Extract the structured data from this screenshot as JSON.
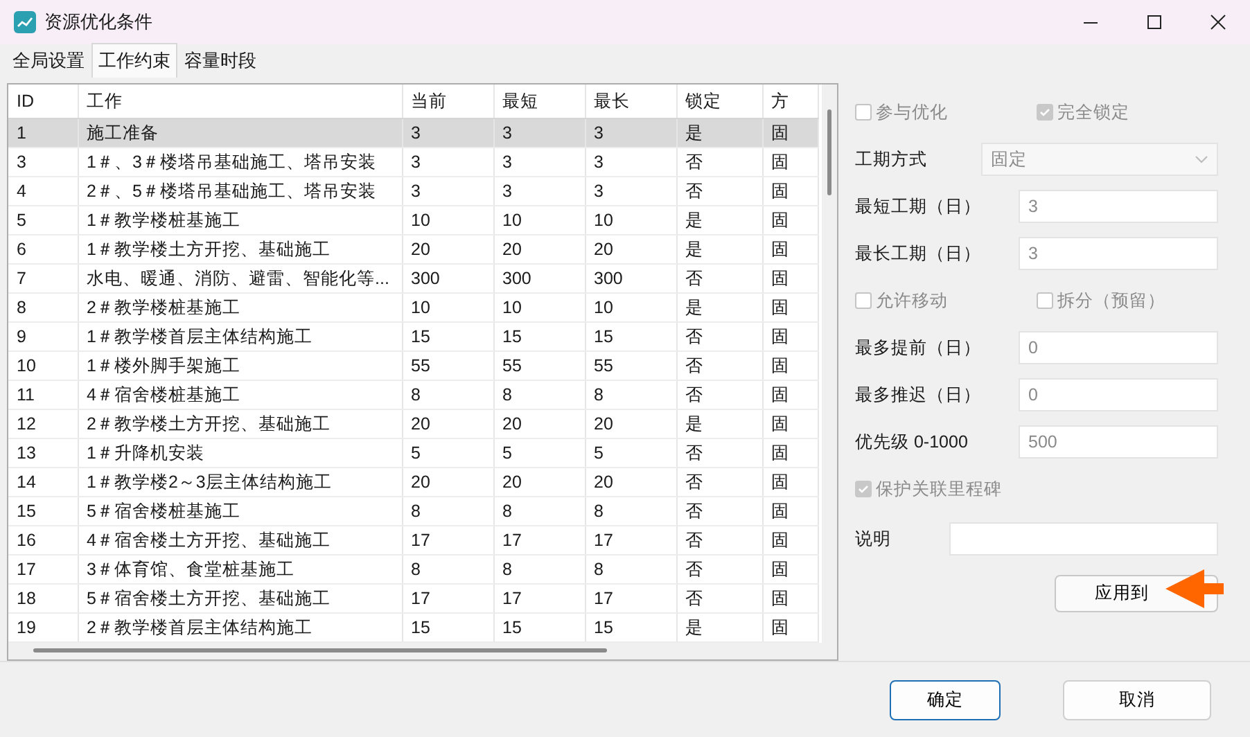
{
  "window": {
    "title": "资源优化条件"
  },
  "tabs": [
    {
      "label": "全局设置",
      "selected": false
    },
    {
      "label": "工作约束",
      "selected": true
    },
    {
      "label": "容量时段",
      "selected": false
    }
  ],
  "table": {
    "columns": [
      "ID",
      "工作",
      "当前",
      "最短",
      "最长",
      "锁定",
      "方"
    ],
    "rows": [
      {
        "cells": [
          "1",
          "施工准备",
          "3",
          "3",
          "3",
          "是",
          "固"
        ],
        "selected": true
      },
      {
        "cells": [
          "3",
          "1＃、3＃楼塔吊基础施工、塔吊安装",
          "3",
          "3",
          "3",
          "否",
          "固"
        ],
        "selected": false
      },
      {
        "cells": [
          "4",
          "2＃、5＃楼塔吊基础施工、塔吊安装",
          "3",
          "3",
          "3",
          "否",
          "固"
        ],
        "selected": false
      },
      {
        "cells": [
          "5",
          "1＃教学楼桩基施工",
          "10",
          "10",
          "10",
          "是",
          "固"
        ],
        "selected": false
      },
      {
        "cells": [
          "6",
          "1＃教学楼土方开挖、基础施工",
          "20",
          "20",
          "20",
          "是",
          "固"
        ],
        "selected": false
      },
      {
        "cells": [
          "7",
          "水电、暖通、消防、避雷、智能化等...",
          "300",
          "300",
          "300",
          "否",
          "固"
        ],
        "selected": false
      },
      {
        "cells": [
          "8",
          "2＃教学楼桩基施工",
          "10",
          "10",
          "10",
          "是",
          "固"
        ],
        "selected": false
      },
      {
        "cells": [
          "9",
          "1＃教学楼首层主体结构施工",
          "15",
          "15",
          "15",
          "否",
          "固"
        ],
        "selected": false
      },
      {
        "cells": [
          "10",
          "1＃楼外脚手架施工",
          "55",
          "55",
          "55",
          "否",
          "固"
        ],
        "selected": false
      },
      {
        "cells": [
          "11",
          "4＃宿舍楼桩基施工",
          "8",
          "8",
          "8",
          "否",
          "固"
        ],
        "selected": false
      },
      {
        "cells": [
          "12",
          "2＃教学楼土方开挖、基础施工",
          "20",
          "20",
          "20",
          "是",
          "固"
        ],
        "selected": false
      },
      {
        "cells": [
          "13",
          "1＃升降机安装",
          "5",
          "5",
          "5",
          "否",
          "固"
        ],
        "selected": false
      },
      {
        "cells": [
          "14",
          "1＃教学楼2～3层主体结构施工",
          "20",
          "20",
          "20",
          "否",
          "固"
        ],
        "selected": false
      },
      {
        "cells": [
          "15",
          "5＃宿舍楼桩基施工",
          "8",
          "8",
          "8",
          "否",
          "固"
        ],
        "selected": false
      },
      {
        "cells": [
          "16",
          "4＃宿舍楼土方开挖、基础施工",
          "17",
          "17",
          "17",
          "否",
          "固"
        ],
        "selected": false
      },
      {
        "cells": [
          "17",
          "3＃体育馆、食堂桩基施工",
          "8",
          "8",
          "8",
          "否",
          "固"
        ],
        "selected": false
      },
      {
        "cells": [
          "18",
          "5＃宿舍楼土方开挖、基础施工",
          "17",
          "17",
          "17",
          "否",
          "固"
        ],
        "selected": false
      },
      {
        "cells": [
          "19",
          "2＃教学楼首层主体结构施工",
          "15",
          "15",
          "15",
          "是",
          "固"
        ],
        "selected": false
      }
    ]
  },
  "form": [
    {
      "kind": "checkboxes",
      "items": [
        {
          "label": "参与优化",
          "checked": false,
          "disabled": true
        },
        {
          "label": "完全锁定",
          "checked": true,
          "disabled": true
        }
      ]
    },
    {
      "kind": "select",
      "label": "工期方式",
      "value": "固定"
    },
    {
      "kind": "input",
      "label": "最短工期（日）",
      "value": "3"
    },
    {
      "kind": "input",
      "label": "最长工期（日）",
      "value": "3"
    },
    {
      "kind": "checkboxes",
      "items": [
        {
          "label": "允许移动",
          "checked": false,
          "disabled": true
        },
        {
          "label": "拆分（预留）",
          "checked": false,
          "disabled": true
        }
      ]
    },
    {
      "kind": "input",
      "label": "最多提前（日）",
      "value": "0"
    },
    {
      "kind": "input",
      "label": "最多推迟（日）",
      "value": "0"
    },
    {
      "kind": "input",
      "label": "优先级 0-1000",
      "value": "500"
    },
    {
      "kind": "checkboxes",
      "items": [
        {
          "label": "保护关联里程碑",
          "checked": true,
          "disabled": true
        }
      ]
    },
    {
      "kind": "note",
      "label": "说明"
    }
  ],
  "apply_button": "应用到",
  "buttons": [
    {
      "label": "确定",
      "default": true
    },
    {
      "label": "取消",
      "default": false
    }
  ]
}
